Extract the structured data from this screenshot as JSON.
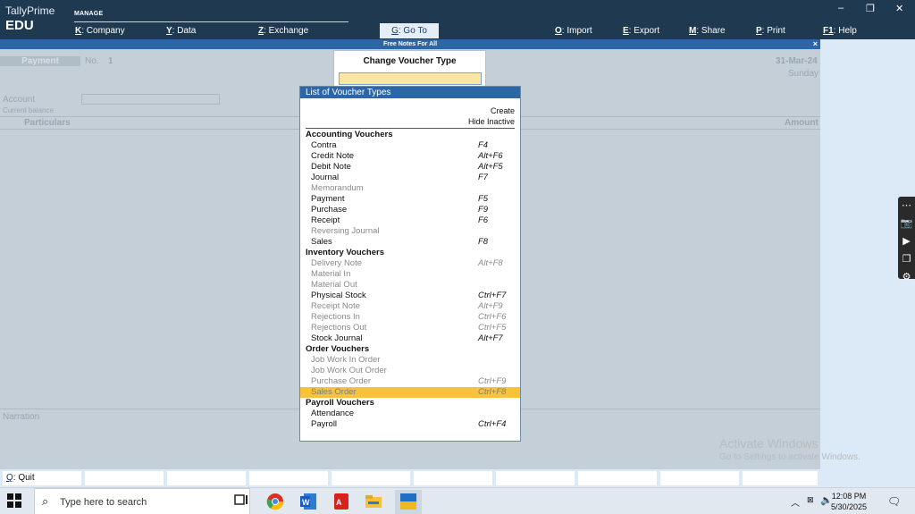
{
  "app": {
    "product": "TallyPrime",
    "edition": "EDU",
    "section": "MANAGE"
  },
  "menu": [
    {
      "key": "K",
      "label": "Company"
    },
    {
      "key": "Y",
      "label": "Data"
    },
    {
      "key": "Z",
      "label": "Exchange"
    },
    {
      "key": "G",
      "label": "Go To"
    },
    {
      "key": "O",
      "label": "Import"
    },
    {
      "key": "E",
      "label": "Export"
    },
    {
      "key": "M",
      "label": "Share"
    },
    {
      "key": "P",
      "label": "Print"
    },
    {
      "key": "F1",
      "label": "Help"
    }
  ],
  "window_controls": {
    "minimize": "–",
    "restore": "❐",
    "close": "✕"
  },
  "subbar": {
    "title": "Free Notes For All",
    "close": "×"
  },
  "voucher": {
    "type": "Payment",
    "no_label": "No.",
    "no": "1",
    "date": "31-Mar-24",
    "day": "Sunday",
    "account_label": "Account",
    "balance_label": "Current balance",
    "particulars_label": "Particulars",
    "amount_label": "Amount",
    "narration_label": "Narration"
  },
  "change_dialog": {
    "title": "Change Voucher Type",
    "value": ""
  },
  "list": {
    "title": "List of Voucher Types",
    "create": "Create",
    "hide_inactive": "Hide Inactive",
    "rows": [
      {
        "name": "Accounting Vouchers",
        "key": "",
        "group": true,
        "inactive": false,
        "selected": false
      },
      {
        "name": "Contra",
        "key": "F4",
        "group": false,
        "inactive": false,
        "selected": false
      },
      {
        "name": "Credit Note",
        "key": "Alt+F6",
        "group": false,
        "inactive": false,
        "selected": false
      },
      {
        "name": "Debit Note",
        "key": "Alt+F5",
        "group": false,
        "inactive": false,
        "selected": false
      },
      {
        "name": "Journal",
        "key": "F7",
        "group": false,
        "inactive": false,
        "selected": false
      },
      {
        "name": "Memorandum",
        "key": "",
        "group": false,
        "inactive": true,
        "selected": false
      },
      {
        "name": "Payment",
        "key": "F5",
        "group": false,
        "inactive": false,
        "selected": false
      },
      {
        "name": "Purchase",
        "key": "F9",
        "group": false,
        "inactive": false,
        "selected": false
      },
      {
        "name": "Receipt",
        "key": "F6",
        "group": false,
        "inactive": false,
        "selected": false
      },
      {
        "name": "Reversing Journal",
        "key": "",
        "group": false,
        "inactive": true,
        "selected": false
      },
      {
        "name": "Sales",
        "key": "F8",
        "group": false,
        "inactive": false,
        "selected": false
      },
      {
        "name": "Inventory Vouchers",
        "key": "",
        "group": true,
        "inactive": false,
        "selected": false
      },
      {
        "name": "Delivery Note",
        "key": "Alt+F8",
        "group": false,
        "inactive": true,
        "selected": false
      },
      {
        "name": "Material In",
        "key": "",
        "group": false,
        "inactive": true,
        "selected": false
      },
      {
        "name": "Material Out",
        "key": "",
        "group": false,
        "inactive": true,
        "selected": false
      },
      {
        "name": "Physical Stock",
        "key": "Ctrl+F7",
        "group": false,
        "inactive": false,
        "selected": false
      },
      {
        "name": "Receipt Note",
        "key": "Alt+F9",
        "group": false,
        "inactive": true,
        "selected": false
      },
      {
        "name": "Rejections In",
        "key": "Ctrl+F6",
        "group": false,
        "inactive": true,
        "selected": false
      },
      {
        "name": "Rejections Out",
        "key": "Ctrl+F5",
        "group": false,
        "inactive": true,
        "selected": false
      },
      {
        "name": "Stock Journal",
        "key": "Alt+F7",
        "group": false,
        "inactive": false,
        "selected": false
      },
      {
        "name": "Order Vouchers",
        "key": "",
        "group": true,
        "inactive": false,
        "selected": false
      },
      {
        "name": "Job Work In Order",
        "key": "",
        "group": false,
        "inactive": true,
        "selected": false
      },
      {
        "name": "Job Work Out Order",
        "key": "",
        "group": false,
        "inactive": true,
        "selected": false
      },
      {
        "name": "Purchase Order",
        "key": "Ctrl+F9",
        "group": false,
        "inactive": true,
        "selected": false
      },
      {
        "name": "Sales Order",
        "key": "Ctrl+F8",
        "group": false,
        "inactive": true,
        "selected": true
      },
      {
        "name": "Payroll Vouchers",
        "key": "",
        "group": true,
        "inactive": false,
        "selected": false
      },
      {
        "name": "Attendance",
        "key": "",
        "group": false,
        "inactive": false,
        "selected": false
      },
      {
        "name": "Payroll",
        "key": "Ctrl+F4",
        "group": false,
        "inactive": false,
        "selected": false
      }
    ]
  },
  "bottom_bar": {
    "quit_key": "Q",
    "quit_label": "Quit"
  },
  "watermark": {
    "line1": "Activate Windows",
    "line2": "Go to Settings to activate Windows."
  },
  "taskbar": {
    "search_placeholder": "Type here to search",
    "time": "12:08 PM",
    "date": "5/30/2025",
    "apps": [
      "task-view-icon",
      "chrome-icon",
      "word-icon",
      "pdf-icon",
      "file-explorer-icon",
      "tally-icon"
    ]
  }
}
